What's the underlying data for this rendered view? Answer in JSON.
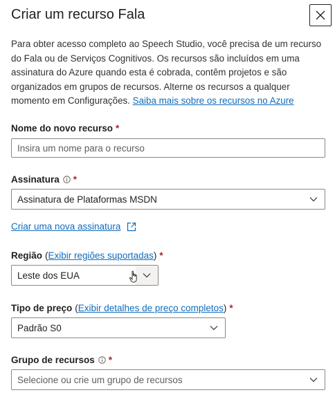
{
  "panel": {
    "title": "Criar um recurso Fala",
    "close_label": "Fechar"
  },
  "intro": {
    "text": "Para obter acesso completo ao Speech Studio, você precisa de um recurso do Fala ou de Serviços Cognitivos. Os recursos são incluídos em uma assinatura do Azure quando esta é cobrada, contêm projetos e são organizados em grupos de recursos. Alterne os recursos a qualquer momento em Configurações. ",
    "link": "Saiba mais sobre os recursos no Azure"
  },
  "form": {
    "resource_name": {
      "label": "Nome do novo recurso",
      "required_mark": "*",
      "placeholder": "Insira um nome para o recurso",
      "value": ""
    },
    "subscription": {
      "label": "Assinatura",
      "required_mark": "*",
      "value": "Assinatura de Plataformas MSDN",
      "create_link": "Criar uma nova assinatura"
    },
    "region": {
      "label": "Região",
      "paren_open": "(",
      "link": "Exibir regiões suportadas",
      "paren_close": ")",
      "required_mark": "*",
      "value": "Leste dos EUA"
    },
    "pricing": {
      "label": "Tipo de preço",
      "paren_open": "(",
      "link": "Exibir detalhes de preço completos",
      "paren_close": ")",
      "required_mark": "*",
      "value": "Padrão S0"
    },
    "resource_group": {
      "label": "Grupo de recursos",
      "required_mark": "*",
      "placeholder": "Selecione ou crie um grupo de recursos"
    }
  },
  "colors": {
    "link": "#0f6cbd",
    "required": "#a4262c",
    "border": "#8a8886"
  }
}
